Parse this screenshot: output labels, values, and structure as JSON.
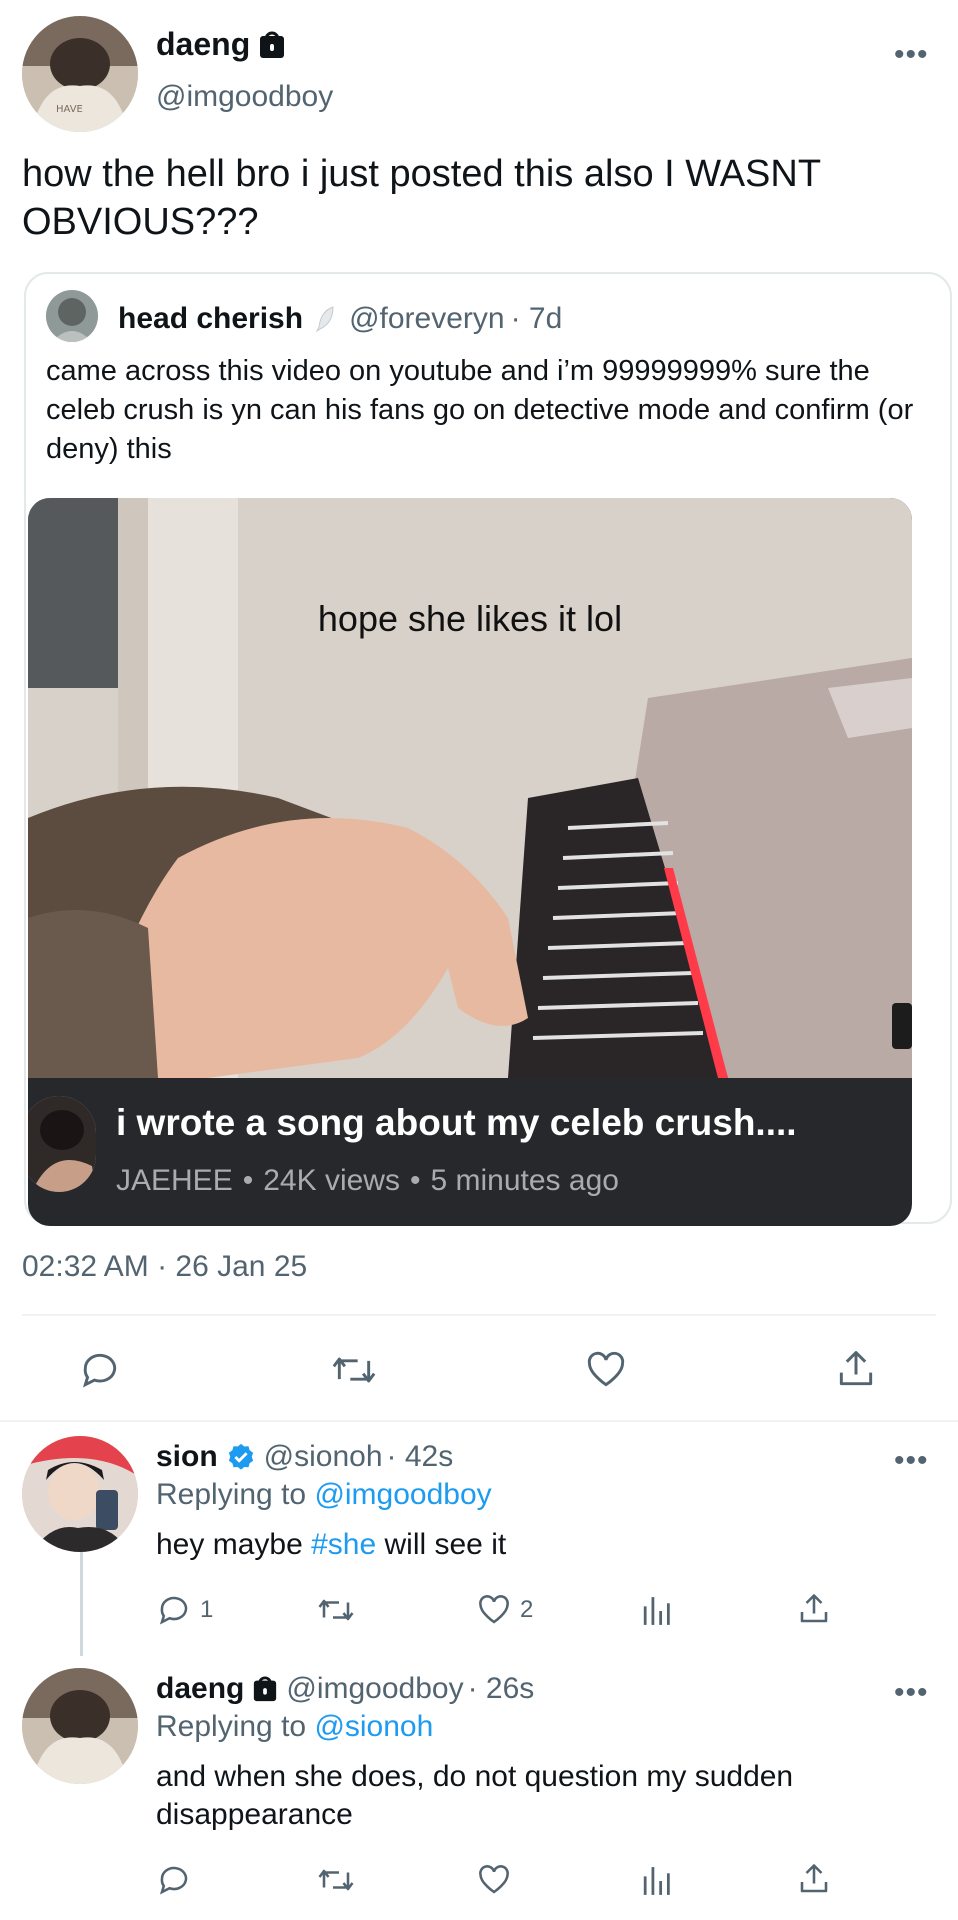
{
  "main_tweet": {
    "author_name": "daeng",
    "author_handle": "@imgoodboy",
    "text": "how the hell bro i just posted this also I WASNT OBVIOUS???",
    "timestamp": "02:32 AM · 26 Jan 25",
    "more_label": "•••"
  },
  "quote": {
    "author_name": "head cherish",
    "author_handle": "@foreveryn",
    "age": "· 7d",
    "text": "came across this video on youtube and i’m 99999999% sure the celeb crush is yn can his fans go on detective mode and confirm (or deny) this",
    "media": {
      "caption_overlay": "hope she likes it lol",
      "video_title": "i wrote a song about my celeb crush....",
      "channel": "JAEHEE",
      "views": "24K views",
      "posted": "5 minutes ago",
      "sep": "•"
    }
  },
  "replies": [
    {
      "author_name": "sion",
      "verified": true,
      "author_handle": "@sionoh",
      "age": "· 42s",
      "replying_prefix": "Replying to",
      "replying_to": "@imgoodboy",
      "text_before": "hey maybe ",
      "hashtag": "#she",
      "text_after": " will see it",
      "reply_count": "1",
      "like_count": "2"
    },
    {
      "author_name": "daeng",
      "author_handle": "@imgoodboy",
      "age": "· 26s",
      "replying_prefix": "Replying to",
      "replying_to": "@sionoh",
      "text": "and when she does, do not question my sudden disappearance"
    }
  ],
  "colors": {
    "accent": "#1d9bf0",
    "muted": "#536471",
    "media_bar": "#26282b"
  }
}
